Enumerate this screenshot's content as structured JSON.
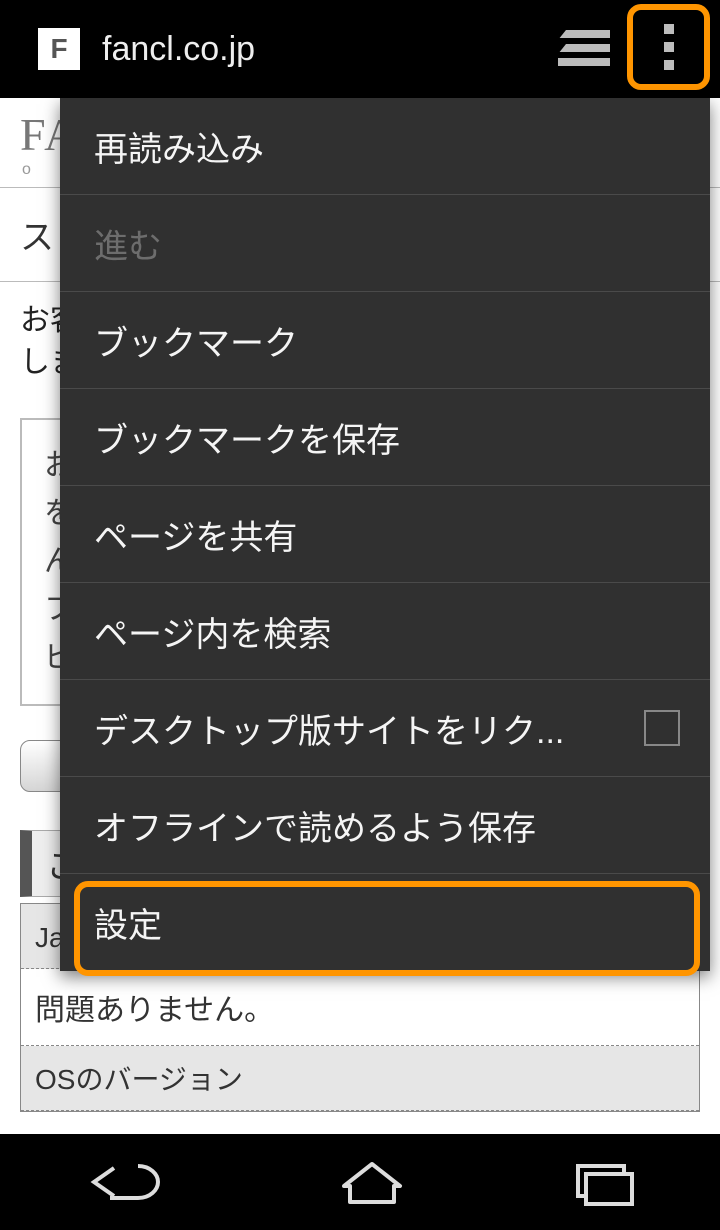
{
  "browser": {
    "favicon_letter": "F",
    "url": "fancl.co.jp"
  },
  "menu": {
    "items": [
      {
        "label": "再読み込み",
        "enabled": true,
        "checkbox": false
      },
      {
        "label": "進む",
        "enabled": false,
        "checkbox": false
      },
      {
        "label": "ブックマーク",
        "enabled": true,
        "checkbox": false
      },
      {
        "label": "ブックマークを保存",
        "enabled": true,
        "checkbox": false
      },
      {
        "label": "ページを共有",
        "enabled": true,
        "checkbox": false
      },
      {
        "label": "ページ内を検索",
        "enabled": true,
        "checkbox": false
      },
      {
        "label": "デスクトップ版サイトをリク...",
        "enabled": true,
        "checkbox": true
      },
      {
        "label": "オフラインで読めるよう保存",
        "enabled": true,
        "checkbox": false
      },
      {
        "label": "設定",
        "enabled": true,
        "checkbox": false
      }
    ]
  },
  "page_bg": {
    "logo_text": "FA",
    "logo_sub": "o n",
    "row1": "ス",
    "desc1": "お客",
    "desc2": "しま",
    "box_lines": "お\nを\nん\nフ\nビ",
    "bar_label": "こ",
    "table_head": "JavaScriptの設定",
    "table_body": "問題ありません。",
    "table_next_head": "OSのバージョン"
  },
  "highlight_color": "#ff9500"
}
